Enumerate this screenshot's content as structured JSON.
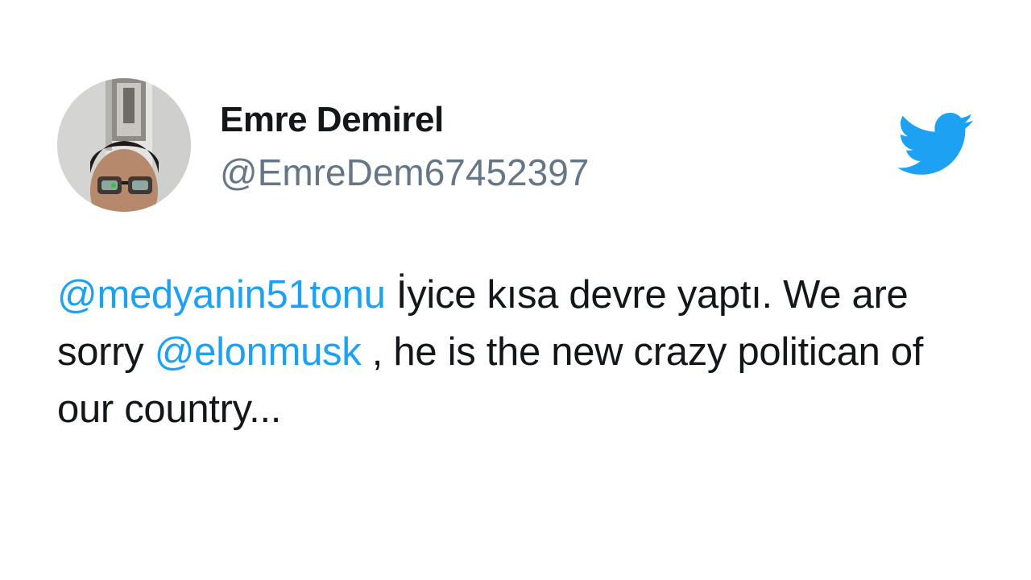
{
  "user": {
    "display_name": "Emre Demirel",
    "handle": "@EmreDem67452397"
  },
  "tweet": {
    "mention_1": "@medyanin51tonu",
    "text_1": " İyice kısa devre yaptı. We are sorry ",
    "mention_2": "@elonmusk",
    "text_2": " , he is the new crazy politican of our country..."
  },
  "icons": {
    "brand": "twitter-bird-icon",
    "avatar": "profile-photo"
  },
  "colors": {
    "mention": "#1da1f2",
    "handle": "#657786",
    "text": "#14171a",
    "brand": "#1da1f2"
  }
}
